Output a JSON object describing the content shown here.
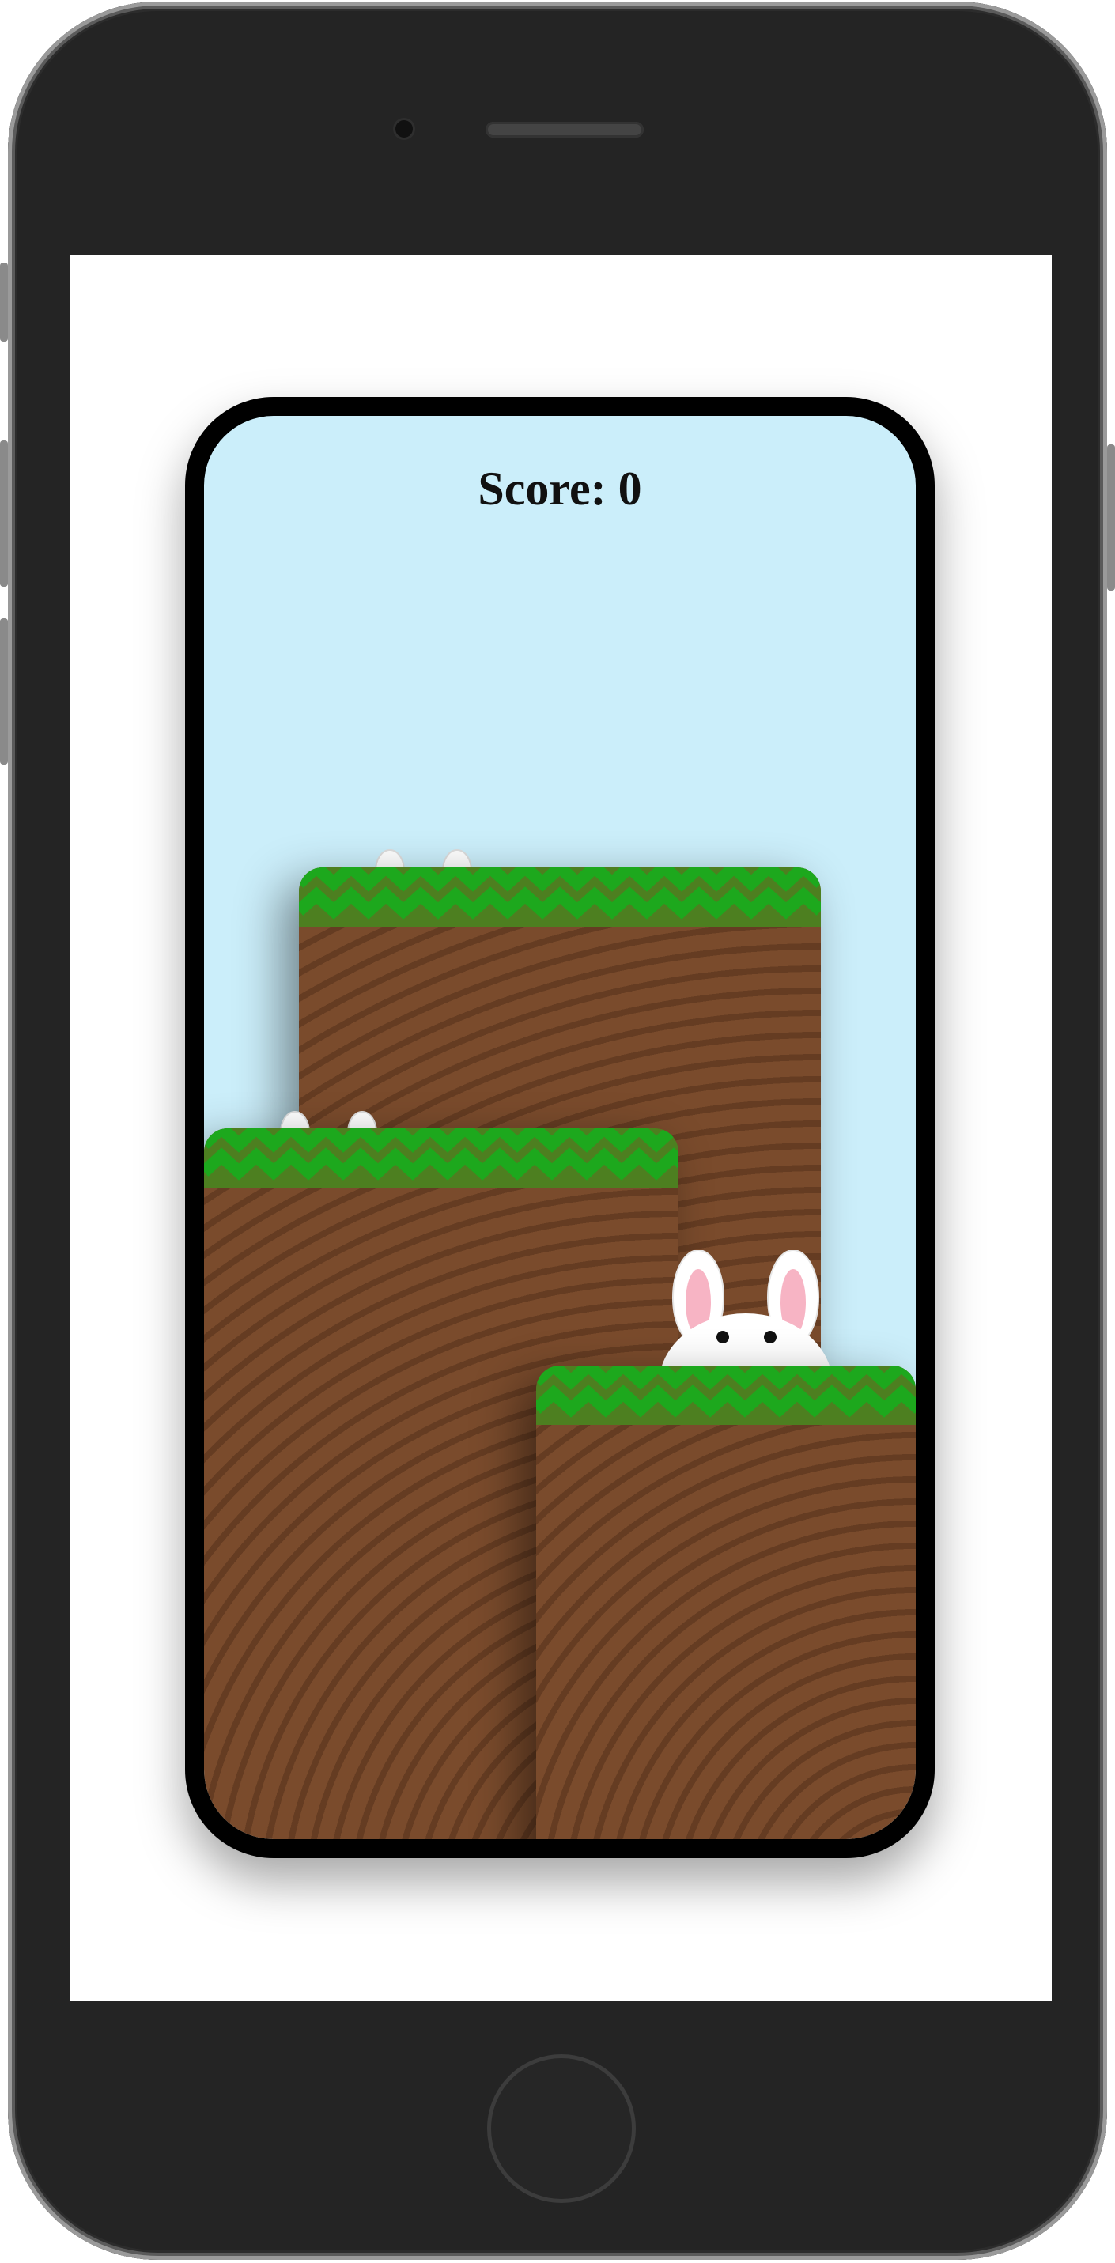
{
  "game": {
    "score_label": "Score:",
    "score_value": "0"
  },
  "colors": {
    "sky": "#cbeefa",
    "grass_dark": "#4d7f20",
    "grass_light": "#1da81d",
    "dirt_light": "#7a4b2c",
    "dirt_dark": "#653c22",
    "bunny_body": "#ffffff",
    "bunny_ear_inner": "#f7b4c4",
    "device_body": "#242424"
  },
  "icons": {
    "bunny": "bunny-icon",
    "home": "home-button-icon",
    "camera": "camera-icon",
    "speaker": "speaker-icon"
  }
}
